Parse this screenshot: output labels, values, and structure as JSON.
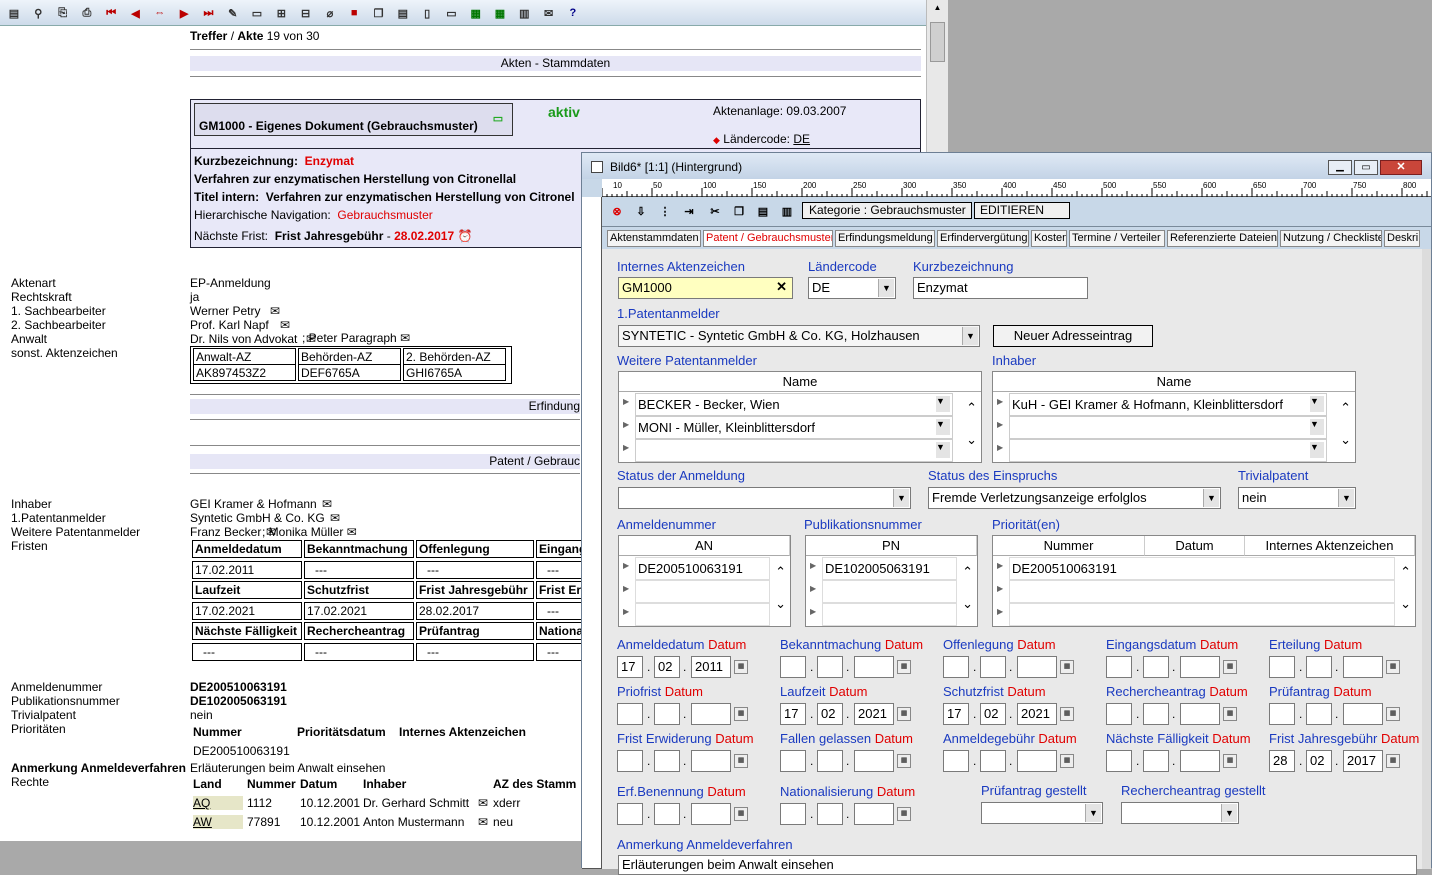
{
  "toolbar_icons": [
    "new-doc",
    "binoculars",
    "copy",
    "print",
    "first",
    "prev",
    "swap",
    "next",
    "last",
    "edit",
    "folder-open",
    "folder-tree",
    "folder-up",
    "attach",
    "book-red",
    "copy2",
    "paste",
    "note",
    "doc",
    "sheet",
    "grid",
    "barcode",
    "mail",
    "help"
  ],
  "header": {
    "treffer": "Treffer",
    "akte": "Akte",
    "position": "19 von 30"
  },
  "sections": {
    "stammdaten": "Akten - Stammdaten",
    "erfindung": "Erfindung",
    "patent": "Patent / Gebrauc"
  },
  "doc": {
    "title": "GM1000 - Eigenes Dokument  (Gebrauchsmuster)",
    "status": "aktiv",
    "anlage": "Aktenanlage: 09.03.2007",
    "laender_label": "Ländercode:",
    "laender": "DE",
    "kurz_label": "Kurzbezeichnung:",
    "kurz": "Enzymat",
    "verfahren": "Verfahren zur enzymatischen Herstellung von Citronellal",
    "titel_label": "Titel intern:",
    "titel": "Verfahren zur enzymatischen Herstellung von Citronel",
    "nav_label": "Hierarchische Navigation:",
    "nav": "Gebrauchsmuster",
    "frist_label": "Nächste Frist:",
    "frist": "Frist Jahresgebühr",
    "frist_date": "28.02.2017"
  },
  "left_fields": [
    {
      "k": "Aktenart",
      "v": "EP-Anmeldung"
    },
    {
      "k": "Rechtskraft",
      "v": "ja"
    },
    {
      "k": "1. Sachbearbeiter",
      "v": "Werner Petry"
    },
    {
      "k": "2. Sachbearbeiter",
      "v": "Prof. Karl Napf"
    },
    {
      "k": "Anwalt",
      "v": "Dr. Nils von Advokat"
    },
    {
      "k": "sonst. Aktenzeichen",
      "v": ""
    }
  ],
  "anwalt2": "Peter Paragraph",
  "az_table": [
    {
      "h": "Anwalt-AZ",
      "v": "AK897453Z2"
    },
    {
      "h": "Behörden-AZ",
      "v": "DEF6765A"
    },
    {
      "h": "2. Behörden-AZ",
      "v": "GHI6765A"
    }
  ],
  "persons": [
    {
      "k": "Inhaber",
      "v": "GEI Kramer & Hofmann"
    },
    {
      "k": "1.Patentanmelder",
      "v": "Syntetic GmbH & Co. KG"
    },
    {
      "k": "Weitere Patentanmelder",
      "v": "Franz Becker"
    },
    {
      "k": "Fristen",
      "v": ""
    }
  ],
  "weitere2": "Monika Müller",
  "fristen_rows": [
    [
      "Anmeldedatum",
      "Bekanntmachung",
      "Offenlegung",
      "Eingang"
    ],
    [
      "17.02.2011",
      "---",
      "---",
      "---"
    ],
    [
      "Laufzeit",
      "Schutzfrist",
      "Frist Jahresgebühr",
      "Frist Er"
    ],
    [
      "17.02.2021",
      "17.02.2021",
      "28.02.2017",
      "---"
    ],
    [
      "Nächste Fälligkeit",
      "Rechercheantrag",
      "Prüfantrag",
      "Nationa"
    ],
    [
      "---",
      "---",
      "---",
      "---"
    ]
  ],
  "nums": [
    {
      "k": "Anmeldenummer",
      "v": "DE200510063191"
    },
    {
      "k": "Publikationsnummer",
      "v": "DE102005063191"
    },
    {
      "k": "Trivialpatent",
      "v": "nein"
    },
    {
      "k": "Prioritäten",
      "v": ""
    }
  ],
  "prio_head": [
    "Nummer",
    "Prioritätsdatum",
    "Internes Aktenzeichen"
  ],
  "prio_val": "DE200510063191",
  "anmerkung_label": "Anmerkung Anmeldeverfahren",
  "anmerkung": "Erläuterungen beim Anwalt einsehen",
  "rechte_label": "Rechte",
  "rechte_head": [
    "Land",
    "Nummer",
    "Datum",
    "Inhaber",
    "AZ des Stamm"
  ],
  "rechte_rows": [
    [
      "AQ",
      "1112",
      "10.12.2001",
      "Dr. Gerhard Schmitt",
      "xderr"
    ],
    [
      "AW",
      "77891",
      "10.12.2001",
      "Anton Mustermann",
      "neu"
    ]
  ],
  "dialog": {
    "title": "Bild6* [1:1] (Hintergrund)",
    "ruler": [
      "10",
      "50",
      "100",
      "150",
      "200",
      "250",
      "300",
      "350",
      "400",
      "450",
      "500",
      "550",
      "600",
      "650",
      "700",
      "750",
      "800"
    ],
    "kategorie": "Kategorie : Gebrauchsmuster",
    "editieren": "EDITIEREN",
    "tabs": [
      "Aktenstammdaten",
      "Patent / Gebrauchsmuster",
      "Erfindungsmeldung",
      "Erfindervergütung",
      "Kosten",
      "Termine / Verteiler",
      "Referenzierte Dateien",
      "Nutzung / Checkliste",
      "Deskri"
    ],
    "f_iaz": "Internes Aktenzeichen",
    "v_iaz": "GM1000",
    "f_lc": "Ländercode",
    "v_lc": "DE",
    "f_kb": "Kurzbezeichnung",
    "v_kb": "Enzymat",
    "f_pa": "1.Patentanmelder",
    "v_pa": "SYNTETIC - Syntetic GmbH & Co. KG, Holzhausen",
    "neu_btn": "Neuer Adresseintrag",
    "f_wpa": "Weitere Patentanmelder",
    "f_inh": "Inhaber",
    "name_col": "Name",
    "wpa_rows": [
      "BECKER - Becker, Wien",
      "MONI - Müller, Kleinblittersdorf",
      ""
    ],
    "inh_rows": [
      "KuH - GEI Kramer & Hofmann, Kleinblittersdorf",
      "",
      ""
    ],
    "f_sta": "Status der Anmeldung",
    "v_sta": "",
    "f_ste": "Status des Einspruchs",
    "v_ste": "Fremde Verletzungsanzeige erfolglos",
    "f_triv": "Trivialpatent",
    "v_triv": "nein",
    "f_an": "Anmeldenummer",
    "an_col": "AN",
    "v_an": "DE200510063191",
    "f_pn": "Publikationsnummer",
    "pn_col": "PN",
    "v_pn": "DE102005063191",
    "f_prio": "Priorität(en)",
    "prio_cols": [
      "Nummer",
      "Datum",
      "Internes Aktenzeichen"
    ],
    "v_prio": "DE200510063191",
    "datum": "Datum",
    "dates": [
      [
        {
          "l": "Anmeldedatum",
          "d": [
            "17",
            "02",
            "2011"
          ]
        },
        {
          "l": "Bekanntmachung",
          "d": [
            "",
            "",
            ""
          ]
        },
        {
          "l": "Offenlegung",
          "d": [
            "",
            "",
            ""
          ]
        },
        {
          "l": "Eingangsdatum",
          "d": [
            "",
            "",
            ""
          ]
        },
        {
          "l": "Erteilung",
          "d": [
            "",
            "",
            ""
          ]
        }
      ],
      [
        {
          "l": "Priofrist",
          "d": [
            "",
            "",
            ""
          ]
        },
        {
          "l": "Laufzeit",
          "d": [
            "17",
            "02",
            "2021"
          ]
        },
        {
          "l": "Schutzfrist",
          "d": [
            "17",
            "02",
            "2021"
          ]
        },
        {
          "l": "Rechercheantrag",
          "d": [
            "",
            "",
            ""
          ]
        },
        {
          "l": "Prüfantrag",
          "d": [
            "",
            "",
            ""
          ]
        }
      ],
      [
        {
          "l": "Frist Erwiderung",
          "d": [
            "",
            "",
            ""
          ]
        },
        {
          "l": "Fallen gelassen",
          "d": [
            "",
            "",
            ""
          ]
        },
        {
          "l": "Anmeldegebühr",
          "d": [
            "",
            "",
            ""
          ]
        },
        {
          "l": "Nächste Fälligkeit",
          "d": [
            "",
            "",
            ""
          ]
        },
        {
          "l": "Frist Jahresgebühr",
          "d": [
            "28",
            "02",
            "2017"
          ]
        }
      ],
      [
        {
          "l": "Erf.Benennung",
          "d": [
            "",
            "",
            ""
          ]
        },
        {
          "l": "Nationalisierung",
          "d": [
            "",
            "",
            ""
          ]
        }
      ]
    ],
    "f_pg": "Prüfantrag gestellt",
    "f_rg": "Rechercheantrag gestellt",
    "f_anm": "Anmerkung Anmeldeverfahren",
    "v_anm": "Erläuterungen beim Anwalt einsehen"
  }
}
